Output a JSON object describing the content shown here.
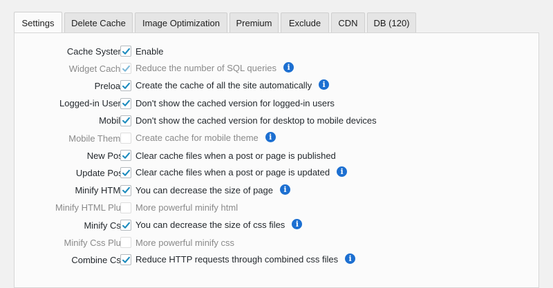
{
  "tabs": [
    {
      "label": "Settings",
      "active": true
    },
    {
      "label": "Delete Cache",
      "active": false
    },
    {
      "label": "Image Optimization",
      "active": false
    },
    {
      "label": "Premium",
      "active": false
    },
    {
      "label": "Exclude",
      "active": false
    },
    {
      "label": "CDN",
      "active": false
    },
    {
      "label": "DB (120)",
      "active": false
    }
  ],
  "colors": {
    "checkmark": "#1e8cbe",
    "info_icon": "#1c6fd1",
    "dim_text": "#8a8a8a"
  },
  "settings": [
    {
      "label": "Cache System:",
      "desc": "Enable",
      "checked": true,
      "enabled": true,
      "info": false
    },
    {
      "label": "Widget Cache:",
      "desc": "Reduce the number of SQL queries",
      "checked": true,
      "enabled": false,
      "info": true
    },
    {
      "label": "Preload:",
      "desc": "Create the cache of all the site automatically",
      "checked": true,
      "enabled": true,
      "info": true
    },
    {
      "label": "Logged-in Users:",
      "desc": "Don't show the cached version for logged-in users",
      "checked": true,
      "enabled": true,
      "info": false
    },
    {
      "label": "Mobile:",
      "desc": "Don't show the cached version for desktop to mobile devices",
      "checked": true,
      "enabled": true,
      "info": false
    },
    {
      "label": "Mobile Theme:",
      "desc": "Create cache for mobile theme",
      "checked": false,
      "enabled": false,
      "info": true
    },
    {
      "label": "New Post:",
      "desc": "Clear cache files when a post or page is published",
      "checked": true,
      "enabled": true,
      "info": false
    },
    {
      "label": "Update Post:",
      "desc": "Clear cache files when a post or page is updated",
      "checked": true,
      "enabled": true,
      "info": true
    },
    {
      "label": "Minify HTML:",
      "desc": "You can decrease the size of page",
      "checked": true,
      "enabled": true,
      "info": true
    },
    {
      "label": "Minify HTML Plus:",
      "desc": "More powerful minify html",
      "checked": false,
      "enabled": false,
      "info": false
    },
    {
      "label": "Minify Css:",
      "desc": "You can decrease the size of css files",
      "checked": true,
      "enabled": true,
      "info": true
    },
    {
      "label": "Minify Css Plus:",
      "desc": "More powerful minify css",
      "checked": false,
      "enabled": false,
      "info": false
    },
    {
      "label": "Combine Css:",
      "desc": "Reduce HTTP requests through combined css files",
      "checked": true,
      "enabled": true,
      "info": true
    }
  ]
}
